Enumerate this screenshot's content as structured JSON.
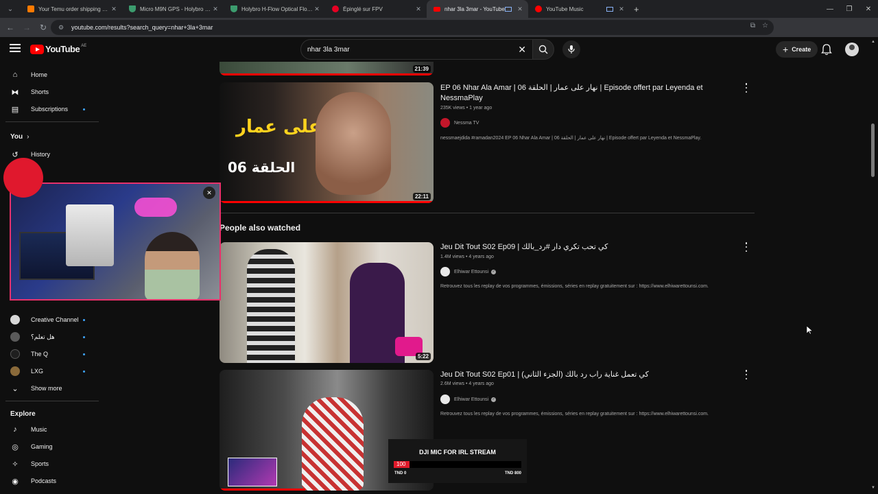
{
  "browser": {
    "tabs": [
      {
        "title": "Your Temu order shipping statu",
        "favicon_color": "#ff7a00",
        "icon": "temu-icon"
      },
      {
        "title": "Micro M9N GPS - Holybro Store",
        "favicon_color": "#3c9c6e",
        "icon": "shield-icon"
      },
      {
        "title": "Holybro H-Flow Optical Flow an",
        "favicon_color": "#3c9c6e",
        "icon": "shield-icon"
      },
      {
        "title": "Épinglé sur FPV",
        "favicon_color": "#e60023",
        "icon": "pinterest-icon"
      },
      {
        "title": "nhar 3la 3mar - YouTube",
        "favicon_color": "#ff0000",
        "icon": "youtube-icon",
        "active": true
      },
      {
        "title": "YouTube Music",
        "favicon_color": "#ff0000",
        "icon": "youtube-music-icon"
      }
    ],
    "url": "youtube.com/results?search_query=nhar+3la+3mar"
  },
  "header": {
    "logo_text": "YouTube",
    "country_code": "AE",
    "search_value": "nhar 3la 3mar",
    "create_label": "Create"
  },
  "sidebar": {
    "main": [
      {
        "label": "Home",
        "icon": "home-icon"
      },
      {
        "label": "Shorts",
        "icon": "shorts-icon"
      },
      {
        "label": "Subscriptions",
        "icon": "subscriptions-icon"
      }
    ],
    "you_label": "You",
    "you_items": [
      {
        "label": "History",
        "icon": "history-icon"
      },
      {
        "label": "lists",
        "icon": "playlists-icon"
      }
    ],
    "subscriptions": [
      {
        "label": "Creative Channel",
        "color": "#d8d8d8"
      },
      {
        "label": "هل تعلم؟",
        "color": "#5a5a5a"
      },
      {
        "label": "The Q",
        "color": "#1f1f1f"
      },
      {
        "label": "LXG",
        "color": "#8a6a3a"
      }
    ],
    "show_more": "Show more",
    "explore_label": "Explore",
    "explore": [
      {
        "label": "Music",
        "icon": "music-icon"
      },
      {
        "label": "Gaming",
        "icon": "gaming-icon"
      },
      {
        "label": "Sports",
        "icon": "sports-icon"
      },
      {
        "label": "Podcasts",
        "icon": "podcasts-icon"
      }
    ]
  },
  "results": {
    "partial_duration": "21:39",
    "video1": {
      "title": "EP 06 Nhar Ala Amar | نهار على عمار | الحلقة 06 | Episode offert par Leyenda et NessmaPlay",
      "meta": "235K views • 1 year ago",
      "channel": "Nessma TV",
      "description": "nessmaejdida #ramadan2024 EP 06 Nhar Ala Amar | نهار على عمار | الحلقة 06 | Episode offert par Leyenda et NessmaPlay.",
      "duration": "22:11",
      "thumb_title": "نهار على عمار",
      "thumb_episode": "الحلقة 06"
    },
    "section_title": "People also watched",
    "video2": {
      "title": "Jeu Dit Tout S02 Ep09 | كي تحب تكري دار #رد_بالك",
      "meta": "1.4M views • 4 years ago",
      "channel": "Elhiwar Ettounsi",
      "description": "Retrouvez tous les replay de vos programmes, émissions, séries en replay gratuitement sur : https://www.elhiwarettounsi.com.",
      "duration": "5:22"
    },
    "video3": {
      "title": "Jeu Dit Tout S02 Ep01 | كي تعمل غناية راب رد بالك (الجزء الثاني)",
      "meta": "2.6M views • 4 years ago",
      "channel": "Elhiwar Ettounsi",
      "description": "Retrouvez tous les replay de vos programmes, émissions, séries en replay gratuitement sur : https://www.elhiwarettounsi.com."
    }
  },
  "donation": {
    "title": "DJI MIC FOR IRL STREAM",
    "current": "100",
    "min": "TND 0",
    "max": "TND 800",
    "progress_fraction": 0.125
  }
}
